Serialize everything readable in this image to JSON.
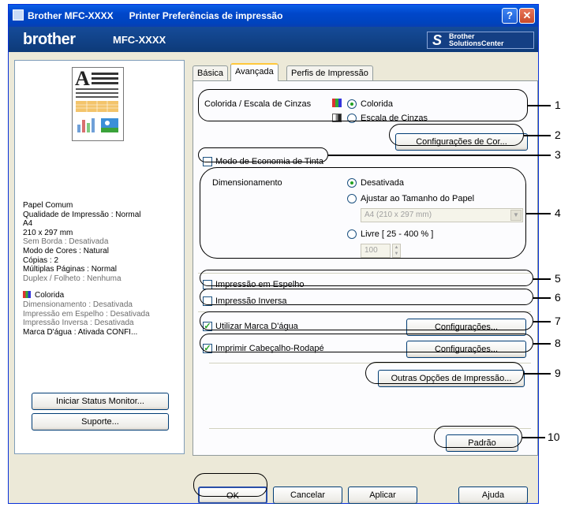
{
  "title_bar": {
    "title": "Brother MFC-XXXX      Printer Preferências de impressão",
    "help": "?",
    "close": "✕"
  },
  "brand_bar": {
    "logo": "brother",
    "model": "MFC-XXXX",
    "solutions_line1": "Brother",
    "solutions_line2": "SolutionsCenter",
    "solutions_glyph": "S"
  },
  "left_panel": {
    "info": [
      {
        "text": "Papel Comum",
        "style": "blue"
      },
      {
        "text": "Qualidade de Impressão : Normal",
        "style": "blue"
      },
      {
        "text": "A4",
        "style": "blue"
      },
      {
        "text": "210 x 297 mm",
        "style": "blue"
      },
      {
        "text": "Sem Borda : Desativada",
        "style": "gray"
      },
      {
        "text": "Modo de Cores : Natural",
        "style": "blue"
      },
      {
        "text": "Cópias : 2",
        "style": "blue"
      },
      {
        "text": "Múltiplas Páginas : Normal",
        "style": "blue"
      },
      {
        "text": "Duplex / Folheto : Nenhuma",
        "style": "gray"
      }
    ],
    "color_label": "Colorida",
    "info2": [
      {
        "text": "Dimensionamento : Desativada",
        "style": "gray"
      },
      {
        "text": "Impressão em Espelho : Desativada",
        "style": "gray"
      },
      {
        "text": "Impressão Inversa : Desativada",
        "style": "gray"
      },
      {
        "text": "Marca D'água : Ativada  CONFI...",
        "style": "blue"
      }
    ],
    "status_monitor_button": "Iniciar Status Monitor...",
    "support_button": "Suporte..."
  },
  "tabs": [
    "Básica",
    "Avançada",
    "Perfis de Impressão"
  ],
  "advanced": {
    "color_group_label": "Colorida / Escala de Cinzas",
    "color_option": "Colorida",
    "gray_option": "Escala de Cinzas",
    "color_settings_button": "Configurações de Cor...",
    "ink_save_label": "Modo de Economia de Tinta",
    "scaling_label": "Dimensionamento",
    "scaling_off": "Desativada",
    "scaling_fit": "Ajustar ao Tamanho do Papel",
    "paper_select": "A4 (210 x 297 mm)",
    "scaling_free": "Livre [ 25 - 400 % ]",
    "free_value": "100",
    "mirror_label": "Impressão em Espelho",
    "reverse_label": "Impressão Inversa",
    "watermark_label": "Utilizar Marca D'água",
    "watermark_settings": "Configurações...",
    "header_footer_label": "Imprimir Cabeçalho-Rodapé",
    "header_footer_settings": "Configurações...",
    "other_options_button": "Outras Opções de Impressão...",
    "default_button": "Padrão"
  },
  "bottom_buttons": {
    "ok": "OK",
    "cancel": "Cancelar",
    "apply": "Aplicar",
    "help": "Ajuda"
  },
  "callouts": [
    "1",
    "2",
    "3",
    "4",
    "5",
    "6",
    "7",
    "8",
    "9",
    "10"
  ]
}
